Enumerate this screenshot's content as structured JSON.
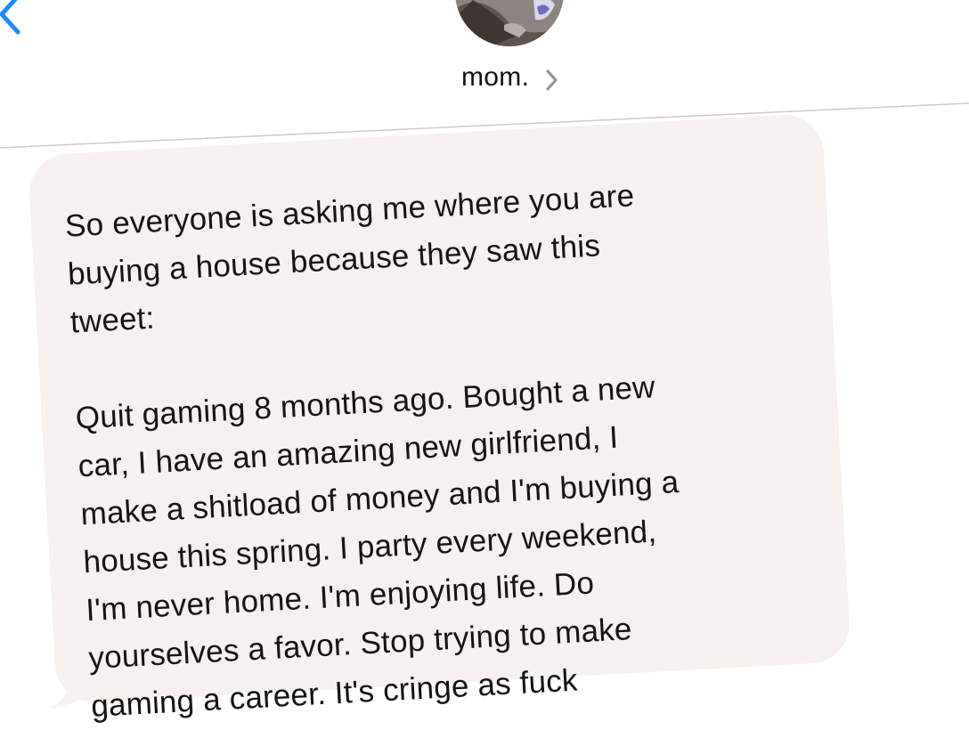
{
  "header": {
    "contact_name": "mom.",
    "back_icon": "chevron-left-icon",
    "contact_detail_icon": "chevron-right-icon"
  },
  "conversation": {
    "messages": [
      {
        "direction": "incoming",
        "text": "So everyone is asking me where you are\nbuying a house because they saw this\ntweet:\n\nQuit gaming 8 months ago. Bought a new\ncar, I have an amazing new girlfriend, I\nmake a shitload of money and I'm buying a\nhouse this spring. I party every weekend,\nI'm never home. I'm enjoying life. Do\nyourselves a favor. Stop trying to make\ngaming a career. It's cringe as fuck"
      }
    ]
  },
  "colors": {
    "accent": "#1a8cff",
    "incoming_bubble": "#f6f0ee",
    "text": "#141414"
  }
}
